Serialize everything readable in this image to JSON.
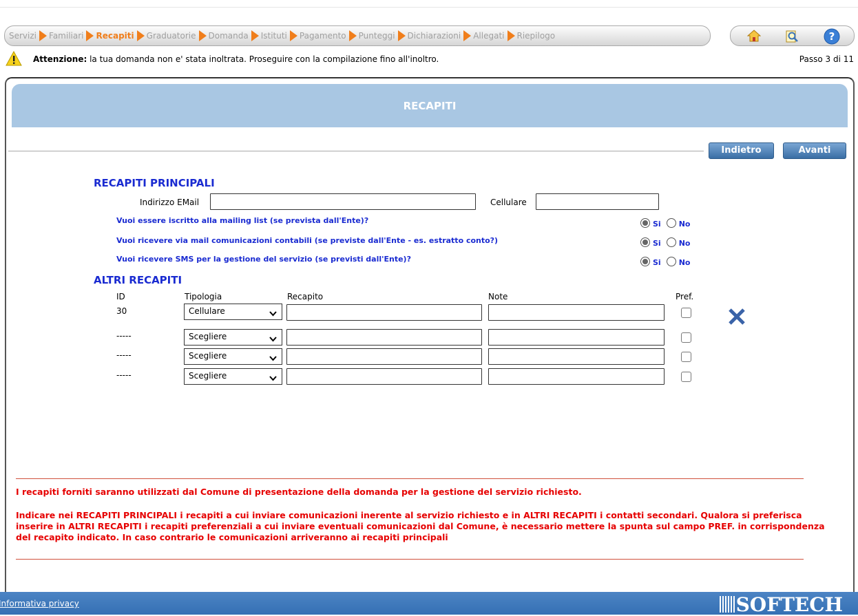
{
  "steps": [
    {
      "label": "Servizi",
      "current": false
    },
    {
      "label": "Familiari",
      "current": false
    },
    {
      "label": "Recapiti",
      "current": true
    },
    {
      "label": "Graduatorie",
      "current": false
    },
    {
      "label": "Domanda",
      "current": false
    },
    {
      "label": "Istituti",
      "current": false
    },
    {
      "label": "Pagamento",
      "current": false
    },
    {
      "label": "Punteggi",
      "current": false
    },
    {
      "label": "Dichiarazioni",
      "current": false
    },
    {
      "label": "Allegati",
      "current": false
    },
    {
      "label": "Riepilogo",
      "current": false
    }
  ],
  "warning": {
    "title": "Attenzione:",
    "text": " la tua domanda non e' stata inoltrata. Proseguire con la compilazione fino all'inoltro.",
    "step_counter": "Passo 3 di 11"
  },
  "page_title": "RECAPITI",
  "nav": {
    "back_label": "Indietro",
    "next_label": "Avanti"
  },
  "principali": {
    "title": "RECAPITI PRINCIPALI",
    "email_label": "Indirizzo EMail",
    "email_value": "",
    "cell_label": "Cellulare",
    "cell_value": "",
    "questions": [
      {
        "text": "Vuoi essere iscritto alla mailing list (se prevista dall'Ente)?",
        "selected": "Si"
      },
      {
        "text": "Vuoi ricevere via mail comunicazioni contabili (se previste dall'Ente - es. estratto conto?)",
        "selected": "Si"
      },
      {
        "text": "Vuoi ricevere SMS per la gestione del servizio (se previsti dall'Ente)?",
        "selected": "Si"
      }
    ],
    "yes_label": "Si",
    "no_label": "No"
  },
  "altri": {
    "title": "ALTRI RECAPITI",
    "headers": {
      "id": "ID",
      "tipologia": "Tipologia",
      "recapito": "Recapito",
      "note": "Note",
      "pref": "Pref."
    },
    "rows": [
      {
        "id": "30",
        "tipologia": "Cellulare",
        "recapito": "",
        "note": "",
        "pref": false
      },
      {
        "id": "-----",
        "tipologia": "Scegliere",
        "recapito": "",
        "note": "",
        "pref": false
      },
      {
        "id": "-----",
        "tipologia": "Scegliere",
        "recapito": "",
        "note": "",
        "pref": false
      },
      {
        "id": "-----",
        "tipologia": "Scegliere",
        "recapito": "",
        "note": "",
        "pref": false
      }
    ]
  },
  "notes": {
    "line1": "I recapiti forniti saranno utilizzati dal Comune di presentazione della domanda per la gestione del servizio richiesto.",
    "line2": "Indicare nei RECAPITI PRINCIPALI i recapiti a cui inviare comunicazioni inerente al servizio richiesto e in ALTRI RECAPITI i contatti secondari. Qualora si preferisca inserire in ALTRI RECAPITI i recapiti preferenziali a cui inviare eventuali comunicazioni dal Comune, è necessario mettere la spunta sul campo PREF. in corrispondenza del recapito indicato. In caso contrario le comunicazioni arriveranno ai recapiti principali"
  },
  "footer": {
    "privacy_label": "Informativa privacy",
    "brand": "SOFTECH"
  },
  "colors": {
    "accent": "#f07e1b",
    "header_band": "#a9c7e3",
    "blue_text": "#1a2bd1",
    "warning_red": "#e60000",
    "footer_blue": "#3570b4"
  }
}
